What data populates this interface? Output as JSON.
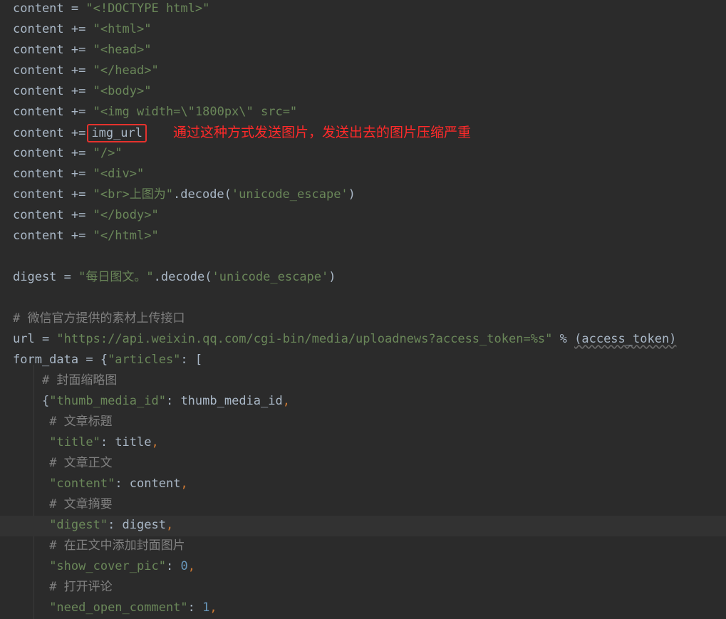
{
  "editor": {
    "lines": [
      {
        "indent": "",
        "tokens": [
          {
            "t": "content = ",
            "c": "plain"
          },
          {
            "t": "\"<!DOCTYPE html>\"",
            "c": "str"
          }
        ]
      },
      {
        "indent": "",
        "tokens": [
          {
            "t": "content += ",
            "c": "plain"
          },
          {
            "t": "\"<html>\"",
            "c": "str"
          }
        ]
      },
      {
        "indent": "",
        "tokens": [
          {
            "t": "content += ",
            "c": "plain"
          },
          {
            "t": "\"<head>\"",
            "c": "str"
          }
        ]
      },
      {
        "indent": "",
        "tokens": [
          {
            "t": "content += ",
            "c": "plain"
          },
          {
            "t": "\"</head>\"",
            "c": "str"
          }
        ]
      },
      {
        "indent": "",
        "tokens": [
          {
            "t": "content += ",
            "c": "plain"
          },
          {
            "t": "\"<body>\"",
            "c": "str"
          }
        ]
      },
      {
        "indent": "",
        "tokens": [
          {
            "t": "content += ",
            "c": "plain"
          },
          {
            "t": "\"<img width=\\\"1800px\\\" src=\"",
            "c": "str"
          }
        ]
      },
      {
        "indent": "",
        "tokens": [
          {
            "t": "content +=",
            "c": "plain"
          },
          {
            "t": "img_url",
            "c": "plain",
            "box": true
          }
        ]
      },
      {
        "indent": "",
        "tokens": [
          {
            "t": "content += ",
            "c": "plain"
          },
          {
            "t": "\"/>\"",
            "c": "str"
          }
        ]
      },
      {
        "indent": "",
        "tokens": [
          {
            "t": "content += ",
            "c": "plain"
          },
          {
            "t": "\"<div>\"",
            "c": "str"
          }
        ]
      },
      {
        "indent": "",
        "tokens": [
          {
            "t": "content += ",
            "c": "plain"
          },
          {
            "t": "\"<br>上图为\"",
            "c": "str"
          },
          {
            "t": ".decode(",
            "c": "plain"
          },
          {
            "t": "'unicode_escape'",
            "c": "str"
          },
          {
            "t": ")",
            "c": "plain"
          }
        ]
      },
      {
        "indent": "",
        "tokens": [
          {
            "t": "content += ",
            "c": "plain"
          },
          {
            "t": "\"</body>\"",
            "c": "str"
          }
        ]
      },
      {
        "indent": "",
        "tokens": [
          {
            "t": "content += ",
            "c": "plain"
          },
          {
            "t": "\"</html>\"",
            "c": "str"
          }
        ]
      },
      {
        "indent": "",
        "tokens": []
      },
      {
        "indent": "",
        "tokens": [
          {
            "t": "digest = ",
            "c": "plain"
          },
          {
            "t": "\"每日图文。\"",
            "c": "str"
          },
          {
            "t": ".decode(",
            "c": "plain"
          },
          {
            "t": "'unicode_escape'",
            "c": "str"
          },
          {
            "t": ")",
            "c": "plain"
          }
        ]
      },
      {
        "indent": "",
        "tokens": []
      },
      {
        "indent": "",
        "tokens": [
          {
            "t": "# 微信官方提供的素材上传接口",
            "c": "comment"
          }
        ]
      },
      {
        "indent": "",
        "tokens": [
          {
            "t": "url = ",
            "c": "plain"
          },
          {
            "t": "\"https://api.weixin.qq.com/cgi-bin/media/uploadnews?access_token=%s\"",
            "c": "str"
          },
          {
            "t": " % ",
            "c": "plain"
          },
          {
            "t": "(access_token)",
            "c": "plain",
            "param": true
          }
        ]
      },
      {
        "indent": "",
        "tokens": [
          {
            "t": "form_data = {",
            "c": "plain"
          },
          {
            "t": "\"articles\"",
            "c": "str"
          },
          {
            "t": ": [",
            "c": "plain"
          }
        ]
      },
      {
        "indent": "    ",
        "tokens": [
          {
            "t": "# 封面缩略图",
            "c": "comment"
          }
        ]
      },
      {
        "indent": "    ",
        "tokens": [
          {
            "t": "{",
            "c": "plain"
          },
          {
            "t": "\"thumb_media_id\"",
            "c": "str"
          },
          {
            "t": ": thumb_media_id",
            "c": "plain"
          },
          {
            "t": ",",
            "c": "punct"
          }
        ]
      },
      {
        "indent": "     ",
        "tokens": [
          {
            "t": "# 文章标题",
            "c": "comment"
          }
        ]
      },
      {
        "indent": "     ",
        "tokens": [
          {
            "t": "\"title\"",
            "c": "str"
          },
          {
            "t": ": title",
            "c": "plain"
          },
          {
            "t": ",",
            "c": "punct"
          }
        ]
      },
      {
        "indent": "     ",
        "tokens": [
          {
            "t": "# 文章正文",
            "c": "comment"
          }
        ]
      },
      {
        "indent": "     ",
        "tokens": [
          {
            "t": "\"content\"",
            "c": "str"
          },
          {
            "t": ": content",
            "c": "plain"
          },
          {
            "t": ",",
            "c": "punct"
          }
        ]
      },
      {
        "indent": "     ",
        "tokens": [
          {
            "t": "# 文章摘要",
            "c": "comment"
          }
        ]
      },
      {
        "indent": "     ",
        "current": true,
        "tokens": [
          {
            "t": "\"digest\"",
            "c": "str"
          },
          {
            "t": ": digest",
            "c": "plain"
          },
          {
            "t": ",",
            "c": "punct"
          }
        ]
      },
      {
        "indent": "     ",
        "tokens": [
          {
            "t": "# 在正文中添加封面图片",
            "c": "comment"
          }
        ]
      },
      {
        "indent": "     ",
        "tokens": [
          {
            "t": "\"show_cover_pic\"",
            "c": "str"
          },
          {
            "t": ": ",
            "c": "plain"
          },
          {
            "t": "0",
            "c": "num"
          },
          {
            "t": ",",
            "c": "punct"
          }
        ]
      },
      {
        "indent": "     ",
        "tokens": [
          {
            "t": "# 打开评论",
            "c": "comment"
          }
        ]
      },
      {
        "indent": "     ",
        "tokens": [
          {
            "t": "\"need_open_comment\"",
            "c": "str"
          },
          {
            "t": ": ",
            "c": "plain"
          },
          {
            "t": "1",
            "c": "num"
          },
          {
            "t": ",",
            "c": "punct"
          }
        ]
      }
    ]
  },
  "annotation": {
    "text": "通过这种方式发送图片，发送出去的图片压缩严重",
    "color": "#ff2a2a"
  },
  "colors": {
    "background": "#2b2b2b",
    "current_line": "#323232",
    "string": "#6a8759",
    "comment": "#808080",
    "keyword_punct": "#cc7832",
    "number": "#6897bb",
    "text": "#a9b7c6"
  }
}
